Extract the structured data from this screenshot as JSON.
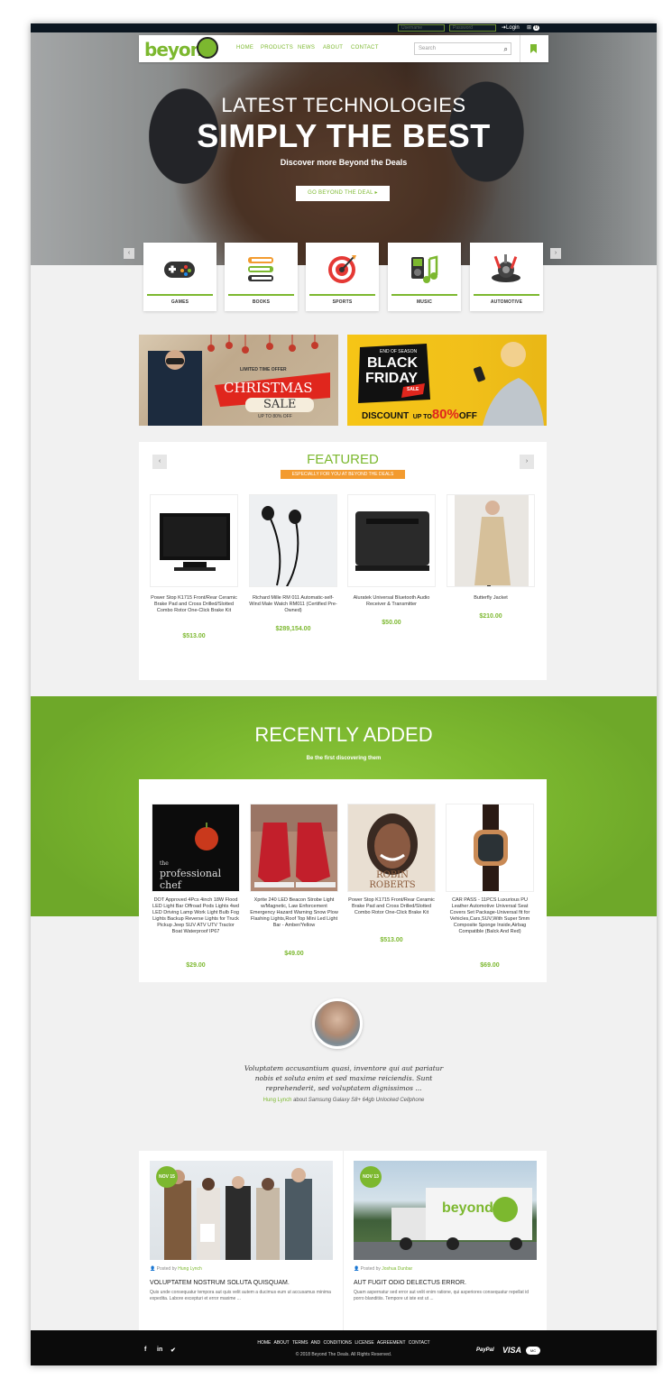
{
  "topbar": {
    "username_placeholder": "Username",
    "password_placeholder": "Password",
    "login_label": "Login",
    "cart_count": "0"
  },
  "nav": {
    "logo_text": "beyond",
    "links": [
      "HOME",
      "PRODUCTS",
      "NEWS",
      "ABOUT",
      "CONTACT"
    ],
    "search_placeholder": "Search"
  },
  "hero": {
    "subtitle": "LATEST TECHNOLOGIES",
    "title": "SIMPLY THE BEST",
    "description": "Discover more Beyond the Deals",
    "button_label": "GO BEYOND THE DEAL ▸",
    "prev_arrow": "‹",
    "next_arrow": "›"
  },
  "categories": [
    {
      "label": "GAMES"
    },
    {
      "label": "BOOKS"
    },
    {
      "label": "SPORTS"
    },
    {
      "label": "MUSIC"
    },
    {
      "label": "AUTOMOTIVE"
    }
  ],
  "banners": {
    "christmas": {
      "line1": "LIMITED TIME OFFER",
      "line2": "CHRISTMAS",
      "line3": "SALE",
      "line4": "UP TO 80% OFF"
    },
    "blackfriday": {
      "line1": "END OF SEASON",
      "line2": "BLACK",
      "line3": "FRIDAY",
      "line4": "SALE",
      "discount_prefix": "DISCOUNT",
      "discount_mid": "UP TO",
      "discount_value": "80%",
      "discount_suffix": "OFF"
    }
  },
  "featured": {
    "title": "FEATURED",
    "subtitle": "ESPECIALLY FOR YOU AT BEYOND THE DEALS",
    "prev": "‹",
    "next": "›",
    "products": [
      {
        "name": "Power Stop K1715 Front/Rear Ceramic Brake Pad and Cross Drilled/Slotted Combo Rotor One-Click Brake Kit",
        "price": "$513.00"
      },
      {
        "name": "Richard Mille RM 011 Automatic-self-Wind Male Watch RM011 (Certified Pre-Owned)",
        "price": "$289,154.00"
      },
      {
        "name": "Aluratek Universal Bluetooth Audio Receiver & Transmitter",
        "price": "$50.00"
      },
      {
        "name": "Butterfly Jacket",
        "price": "$210.00"
      }
    ]
  },
  "recent": {
    "title": "RECENTLY ADDED",
    "subtitle": "Be the first discovering them",
    "products": [
      {
        "name": "DOT Approved 4Pcs 4inch 18W Flood LED Light Bar Offroad Pods Lights 4wd LED Driving Lamp Work Light Bulb Fog Lights Backup Reverse Lights for Truck Pickup Jeep SUV ATV UTV Tractor Boat Waterproof IP67",
        "price": "$29.00",
        "book_line1": "the",
        "book_line2": "professional chef"
      },
      {
        "name": "Xprite 240 LED Beacon Strobe Light w/Magnetic, Law Enforcement Emergency Hazard Warning Snow Plow Flashing Lights,Roof Top Mini Led Light Bar - Amber/Yellow",
        "price": "$49.00"
      },
      {
        "name": "Power Stop K1715 Front/Rear Ceramic Brake Pad and Cross Drilled/Slotted Combo Rotor One-Click Brake Kit",
        "price": "$513.00",
        "book_line1": "ROBIN",
        "book_line2": "ROBERTS"
      },
      {
        "name": "CAR PASS - 11PCS Luxurious PU Leather Automotive Universal Seat Covers Set Package-Universal fit for Vehicles,Cars,SUV,With Super 5mm Composite Sponge Inside,Airbag Compatible (Balck And Red)",
        "price": "$69.00"
      }
    ]
  },
  "testimonial": {
    "quote": "Voluptatem accusantium quasi, inventore qui aut pariatur nobis et soluta enim et sed maxime reiciendis. Sunt reprehenderit, sed voluptatem dignissimos ...",
    "author": "Hung Lynch",
    "about": "about",
    "product": "Samsung Galaxy S8+ 64gb Unlocked Cellphone"
  },
  "blog": [
    {
      "date": "NOV 15",
      "meta_prefix": "Posted by",
      "author": "Hung Lynch",
      "title": "VOLUPTATEM NOSTRUM SOLUTA QUISQUAM.",
      "excerpt": "Quis unde consequatur tempora aut quis velit autem a ducimus eum ut accusamus minima expedita. Labore excepturi et error maxime ..."
    },
    {
      "date": "NOV 13",
      "meta_prefix": "Posted by",
      "author": "Joshua Dunbar",
      "title": "AUT FUGIT ODIO DELECTUS ERROR.",
      "excerpt": "Quam aspernatur sed error aut velit enim ratione, qui asperiores consequatur repellat id porro blanditiis. Tempore ut iste est ut ...",
      "truck_logo": "beyond"
    }
  ],
  "footer": {
    "links": [
      "HOME",
      "ABOUT",
      "TERMS AND CONDITIONS",
      "LICENSE AGREEMENT",
      "CONTACT"
    ],
    "copyright": "© 2018 Beyond The Deals. All Rights Reserved.",
    "social": [
      "f",
      "in",
      "✔"
    ],
    "payments": [
      "PayPal",
      "VISA",
      "MC"
    ]
  },
  "colors": {
    "accent": "#7cb82f",
    "orange": "#f39b2f",
    "dark": "#0b0b0b"
  }
}
